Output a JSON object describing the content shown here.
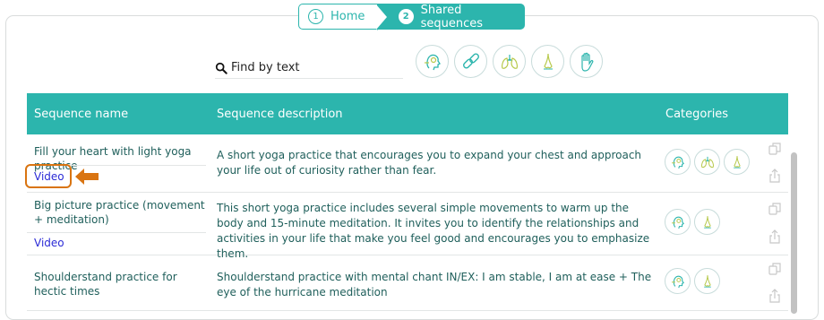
{
  "breadcrumb": {
    "home": {
      "num": "1",
      "label": "Home"
    },
    "shared": {
      "num": "2",
      "label": "Shared sequences"
    }
  },
  "search": {
    "placeholder": "Find by text"
  },
  "filters": [
    "head-icon",
    "link-icon",
    "lungs-icon",
    "nose-icon",
    "hand-icon"
  ],
  "table": {
    "headers": {
      "name": "Sequence name",
      "description": "Sequence description",
      "categories": "Categories"
    },
    "rows": [
      {
        "name": "Fill your heart with light yoga practice",
        "video": "Video",
        "description": "A short yoga practice that encourages you to expand your chest and approach your life out of curiosity rather than fear.",
        "categories": [
          "head-icon",
          "lungs-icon",
          "nose-icon"
        ]
      },
      {
        "name": "Big picture practice (movement + meditation)",
        "video": "Video",
        "description": "This short yoga practice includes several simple movements to warm up the body and 15-minute meditation. It invites you to identify the relationships and activities in your life that make you feel good and encourages you to emphasize them.",
        "categories": [
          "head-icon",
          "nose-icon"
        ]
      },
      {
        "name": "Shoulderstand practice for hectic times",
        "video": "",
        "description": "Shoulderstand practice with mental chant IN/EX: I am stable, I am at ease + The eye of the hurricane meditation",
        "categories": [
          "head-icon",
          "nose-icon"
        ]
      }
    ]
  },
  "colors": {
    "accent": "#2cb5ad",
    "highlight": "#d97411",
    "link": "#2b2bd6"
  }
}
